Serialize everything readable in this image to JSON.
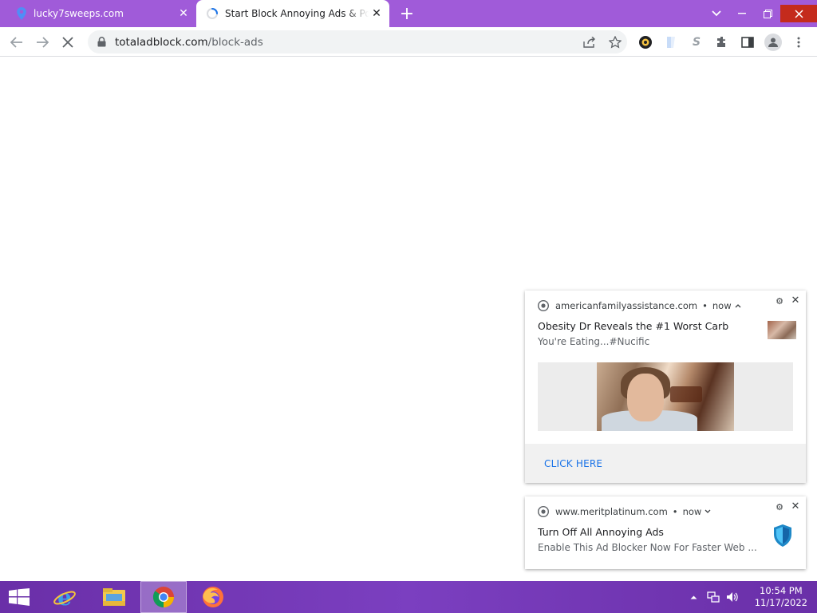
{
  "browser": {
    "tabs": [
      {
        "title": "lucky7sweeps.com",
        "active": false,
        "icon": "location-pin-icon"
      },
      {
        "title": "Start Block Annoying Ads & Pop-ups",
        "active": true,
        "icon": "loading-spinner-icon"
      }
    ],
    "new_tab_symbol": "+",
    "address_bar": {
      "domain": "totaladblock.com",
      "path": "/block-ads"
    },
    "extensions": [
      "extension-circle-icon",
      "extension-cube-icon",
      "extension-s-icon",
      "puzzle-icon"
    ]
  },
  "notifications": [
    {
      "source": "americanfamilyassistance.com",
      "time": "now",
      "title": "Obesity Dr Reveals the #1 Worst Carb",
      "body": "You're Eating...#Nucific",
      "action": "CLICK HERE",
      "expanded": true
    },
    {
      "source": "www.meritplatinum.com",
      "time": "now",
      "title": "Turn Off All Annoying Ads",
      "body": "Enable This Ad Blocker Now For Faster Web ...",
      "icon": "shield-icon",
      "expanded": false
    }
  ],
  "taskbar": {
    "apps": [
      "internet-explorer-icon",
      "file-explorer-icon",
      "chrome-icon",
      "firefox-icon"
    ],
    "active_app": "chrome-icon",
    "time": "10:54 PM",
    "date": "11/17/2022"
  },
  "colors": {
    "tabstrip": "#a05bd9",
    "taskbar": "#7b3fc0",
    "link": "#1a73e8",
    "close_hover": "#c42b1c"
  }
}
